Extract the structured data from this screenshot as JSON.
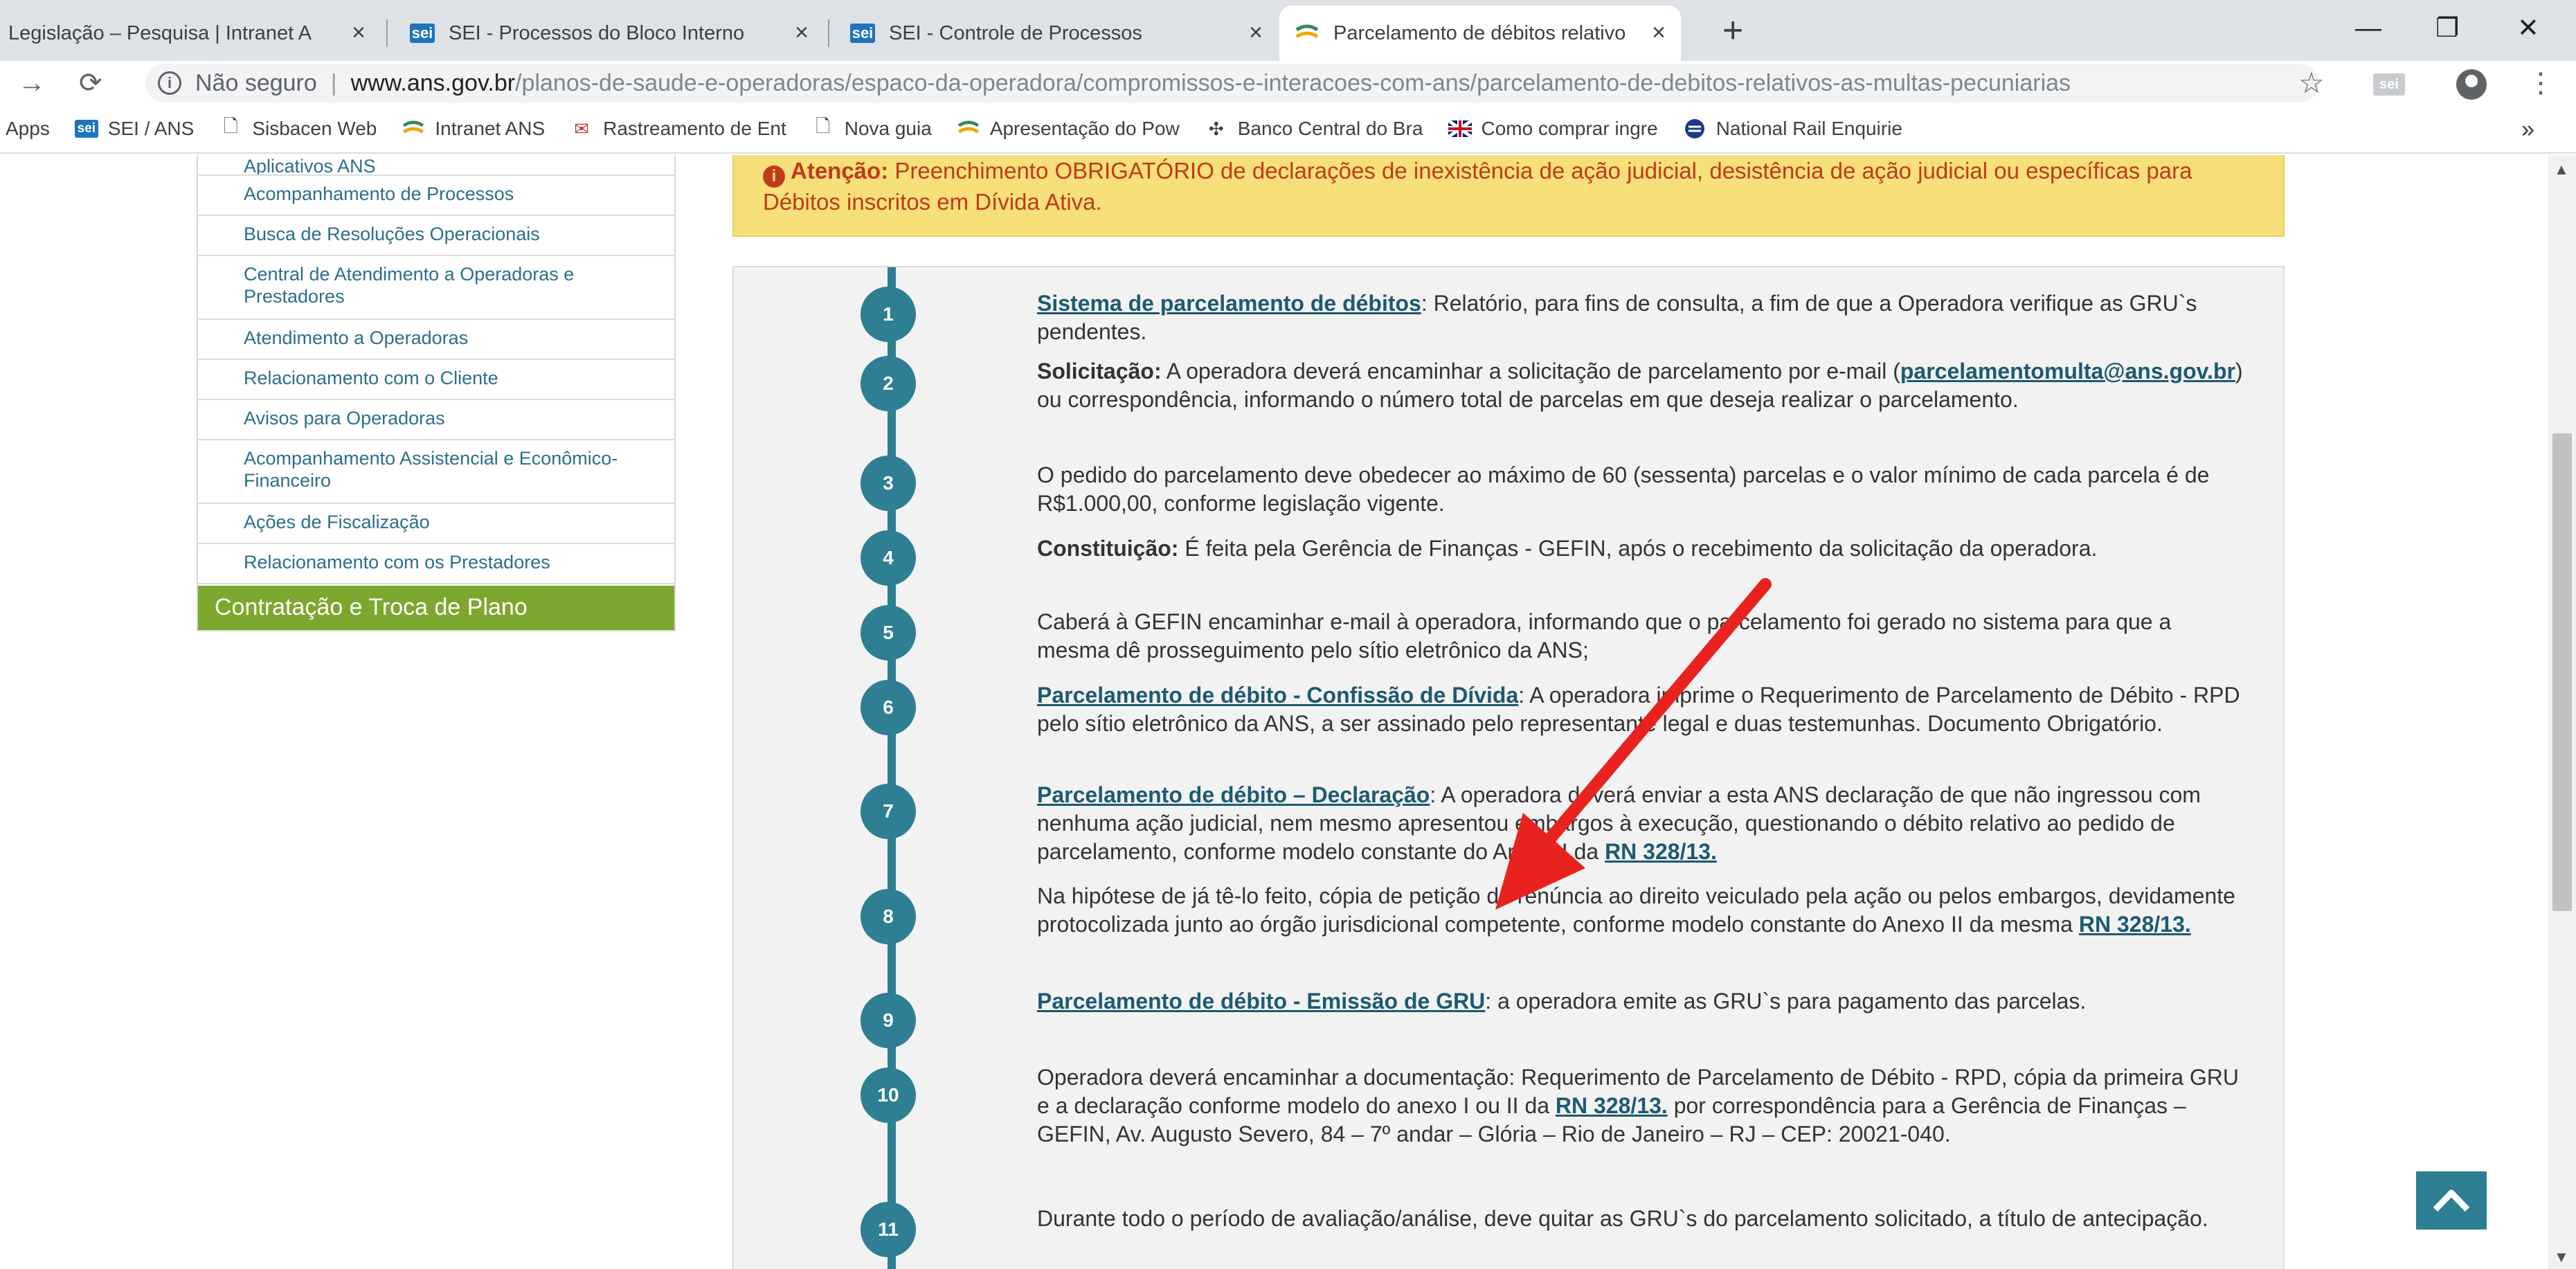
{
  "browser": {
    "tabs": [
      {
        "title": "Legislação – Pesquisa | Intranet A",
        "favicon": "partial-icon",
        "active": false
      },
      {
        "title": "SEI - Processos do Bloco Interno",
        "favicon": "sei-icon",
        "active": false
      },
      {
        "title": "SEI - Controle de Processos",
        "favicon": "sei-icon",
        "active": false
      },
      {
        "title": "Parcelamento de débitos relativo",
        "favicon": "ans-icon",
        "active": true
      }
    ],
    "new_tab_label": "+",
    "security_label": "Não seguro",
    "url_host": "www.ans.gov.br",
    "url_path": "/planos-de-saude-e-operadoras/espaco-da-operadora/compromissos-e-interacoes-com-ans/parcelamento-de-debitos-relativos-as-multas-pecuniarias",
    "extension_label": "sei"
  },
  "bookmarks": [
    {
      "label": "Apps",
      "icon": "apps-icon"
    },
    {
      "label": "SEI / ANS",
      "icon": "sei-icon"
    },
    {
      "label": "Sisbacen Web",
      "icon": "page-icon"
    },
    {
      "label": "Intranet ANS",
      "icon": "ans-icon"
    },
    {
      "label": "Rastreamento de Ent",
      "icon": "mail-icon"
    },
    {
      "label": "Nova guia",
      "icon": "page-icon"
    },
    {
      "label": "Apresentação do Pow",
      "icon": "ans-icon"
    },
    {
      "label": "Banco Central do Bra",
      "icon": "bcb-icon"
    },
    {
      "label": "Como comprar ingre",
      "icon": "uk-flag-icon"
    },
    {
      "label": "National Rail Enquirie",
      "icon": "rail-icon"
    }
  ],
  "bookmarks_more": "»",
  "sidebar": {
    "items": [
      {
        "label": "Aplicativos ANS"
      },
      {
        "label": "Acompanhamento de Processos"
      },
      {
        "label": "Busca de Resoluções Operacionais"
      },
      {
        "label": "Central de Atendimento a Operadoras e Prestadores"
      },
      {
        "label": "Atendimento a Operadoras"
      },
      {
        "label": "Relacionamento com o Cliente"
      },
      {
        "label": "Avisos para Operadoras"
      },
      {
        "label": "Acompanhamento Assistencial e Econômico-Financeiro"
      },
      {
        "label": "Ações de Fiscalização"
      },
      {
        "label": "Relacionamento com os Prestadores"
      }
    ],
    "active_item": "Contratação e Troca de Plano"
  },
  "attention": {
    "icon": "info-icon",
    "lead": "Atenção:",
    "text": " Preenchimento OBRIGATÓRIO de declarações de inexistência de ação judicial, desistência de ação judicial ou específicas para Débitos inscritos em Dívida Ativa."
  },
  "steps": [
    {
      "number": "1",
      "link": "Sistema de parcelamento de débitos",
      "text": ": Relatório, para fins de consulta, a fim de que a Operadora verifique as GRU`s pendentes."
    },
    {
      "number": "2",
      "lead": "Solicitação:",
      "text_a": " A operadora deverá encaminhar a solicitação de parcelamento por e-mail (",
      "email": "parcelamentomulta@ans.gov.br",
      "text_b": ") ou correspondência, informando o número total de parcelas em que deseja realizar o parcelamento."
    },
    {
      "number": "3",
      "text": "O pedido do parcelamento deve obedecer ao máximo de 60 (sessenta) parcelas e o valor mínimo de cada parcela é de R$1.000,00, conforme legislação vigente."
    },
    {
      "number": "4",
      "lead": "Constituição:",
      "text": " É feita pela Gerência de Finanças - GEFIN, após o recebimento da solicitação da operadora."
    },
    {
      "number": "5",
      "text": "Caberá à GEFIN encaminhar e-mail à operadora, informando que o parcelamento foi gerado no sistema para que a mesma dê prosseguimento pelo sítio eletrônico da ANS;"
    },
    {
      "number": "6",
      "link": "Parcelamento de débito - Confissão de Dívida",
      "text": ": A operadora imprime o Requerimento de Parcelamento de Débito - RPD pelo sítio eletrônico da ANS, a ser assinado pelo representante legal e duas testemunhas. Documento Obrigatório."
    },
    {
      "number": "7",
      "link": "Parcelamento de débito – Declaração",
      "text": ": A operadora deverá enviar a esta ANS declaração de que não ingressou com nenhuma ação judicial, nem mesmo apresentou embargos à execução, questionando o débito relativo ao pedido de parcelamento, conforme modelo constante do Anexo I da ",
      "rn": "RN 328/13."
    },
    {
      "number": "8",
      "text": "Na hipótese de já tê-lo feito, cópia de petição de renúncia ao direito veiculado pela ação ou pelos embargos, devidamente protocolizada junto ao órgão jurisdicional competente, conforme modelo constante do Anexo II da mesma ",
      "rn": "RN 328/13."
    },
    {
      "number": "9",
      "link": "Parcelamento de débito - Emissão de GRU",
      "text": ": a operadora emite as GRU`s para pagamento das parcelas."
    },
    {
      "number": "10",
      "text_a": "Operadora deverá encaminhar a documentação: Requerimento de Parcelamento de Débito - RPD, cópia da primeira GRU e a declaração conforme modelo do anexo I ou II da ",
      "rn": "RN 328/13.",
      "text_b": " por correspondência para a Gerência de Finanças – GEFIN, Av. Augusto Severo, 84 – 7º andar – Glória – Rio de Janeiro – RJ – CEP: 20021-040."
    },
    {
      "number": "11",
      "text": "Durante todo o período de avaliação/análise, deve quitar as GRU`s do parcelamento solicitado, a título de antecipação."
    }
  ],
  "annotation": {
    "color": "#e8231f"
  },
  "colors": {
    "accent": "#2e7f93",
    "sidebar_active": "#7da72e",
    "attention_bg": "#f7e07a",
    "attention_text": "#c0391b"
  }
}
